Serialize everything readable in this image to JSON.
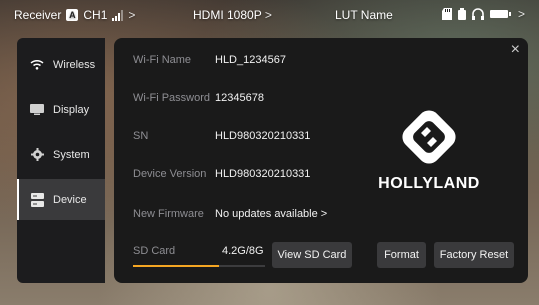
{
  "topbar": {
    "mode": "Receiver",
    "badge": "A",
    "channel": "CH1",
    "video_format": "HDMI 1080P",
    "lut": "LUT Name",
    "chevron": ">"
  },
  "sidebar": {
    "items": [
      {
        "label": "Wireless",
        "icon": "wifi-icon"
      },
      {
        "label": "Display",
        "icon": "display-icon"
      },
      {
        "label": "System",
        "icon": "gear-icon"
      },
      {
        "label": "Device",
        "icon": "device-icon",
        "active": true
      }
    ]
  },
  "panel": {
    "close": "×",
    "rows": [
      {
        "label": "Wi-Fi Name",
        "value": "HLD_1234567"
      },
      {
        "label": "Wi-Fi Password",
        "value": "12345678"
      },
      {
        "label": "SN",
        "value": "HLD980320210331"
      },
      {
        "label": "Device Version",
        "value": "HLD980320210331"
      },
      {
        "label": "New Firmware",
        "value": "No updates available  >"
      }
    ],
    "brand": "HOLLYLAND",
    "sd": {
      "label": "SD Card",
      "value": "4.2G/8G",
      "used_fraction": 0.65,
      "view_button": "View SD Card"
    },
    "format_button": "Format",
    "factory_reset_button": "Factory Reset"
  },
  "colors": {
    "accent": "#f5a623",
    "panel_bg": "#1a1a1a",
    "sidebar_bg": "#1c1c1e",
    "button_bg": "#3a3a3c"
  }
}
